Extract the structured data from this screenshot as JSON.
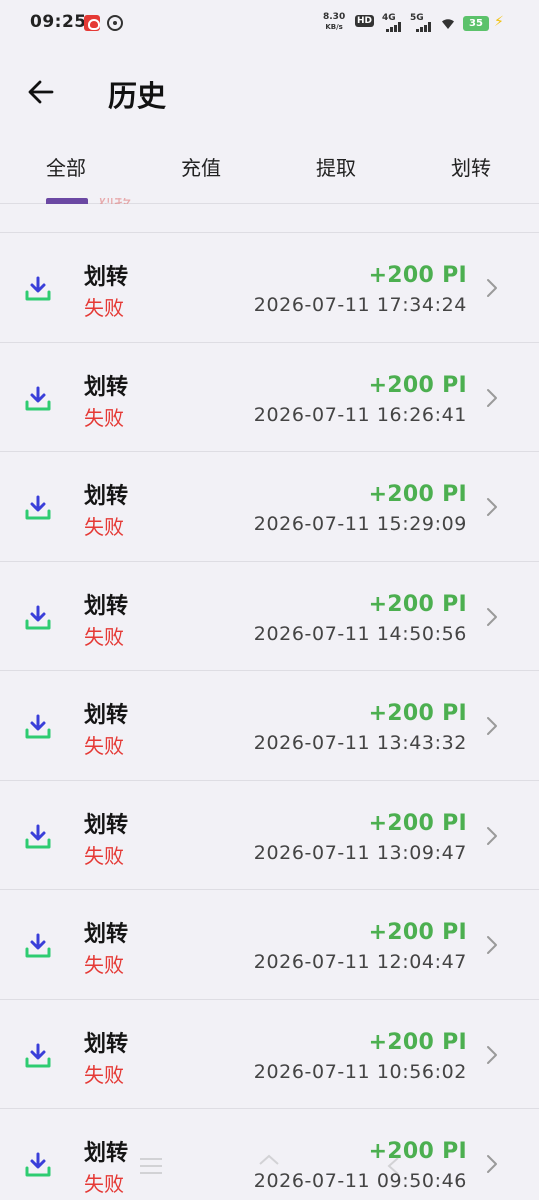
{
  "status_bar": {
    "time": "09:25",
    "net_speed_value": "8.30",
    "net_speed_unit": "KB/s",
    "hd_label": "HD",
    "net1_label": "4G",
    "net2_label": "5G",
    "battery": "35"
  },
  "header": {
    "title": "历史"
  },
  "tabs": [
    {
      "label": "全部",
      "active": true
    },
    {
      "label": "充值",
      "active": false
    },
    {
      "label": "提取",
      "active": false
    },
    {
      "label": "划转",
      "active": false
    }
  ],
  "partial_row_text": "划转",
  "transactions": [
    {
      "title": "划转",
      "status": "失败",
      "amount": "+200 PI",
      "datetime": "2026-07-11 17:34:24"
    },
    {
      "title": "划转",
      "status": "失败",
      "amount": "+200 PI",
      "datetime": "2026-07-11 16:26:41"
    },
    {
      "title": "划转",
      "status": "失败",
      "amount": "+200 PI",
      "datetime": "2026-07-11 15:29:09"
    },
    {
      "title": "划转",
      "status": "失败",
      "amount": "+200 PI",
      "datetime": "2026-07-11 14:50:56"
    },
    {
      "title": "划转",
      "status": "失败",
      "amount": "+200 PI",
      "datetime": "2026-07-11 13:43:32"
    },
    {
      "title": "划转",
      "status": "失败",
      "amount": "+200 PI",
      "datetime": "2026-07-11 13:09:47"
    },
    {
      "title": "划转",
      "status": "失败",
      "amount": "+200 PI",
      "datetime": "2026-07-11 12:04:47"
    },
    {
      "title": "划转",
      "status": "失败",
      "amount": "+200 PI",
      "datetime": "2026-07-11 10:56:02"
    },
    {
      "title": "划转",
      "status": "失败",
      "amount": "+200 PI",
      "datetime": "2026-07-11 09:50:46"
    }
  ],
  "colors": {
    "background": "#f2f1f6",
    "accent": "#6b48a3",
    "amount_green": "#4caf50",
    "status_red": "#e53935",
    "icon_blue": "#3a3fd9",
    "icon_green": "#2ecc71"
  },
  "icons": {
    "back": "arrow-left-icon",
    "row": "download-icon",
    "row_chevron": "chevron-right-icon"
  }
}
